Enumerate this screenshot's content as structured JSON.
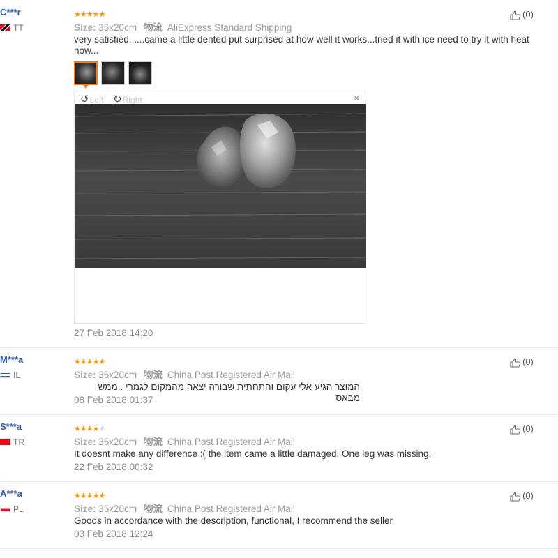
{
  "reviews": [
    {
      "user": "C***r",
      "country": "TT",
      "rating": 5,
      "size_label": "Size:",
      "size_value": "35x20cm",
      "ship_icon": "物流",
      "shipping": "AliExpress Standard Shipping",
      "text": "very satisfied. ....came a little dented put surprised at how well it works...tried it with ice need to try it with heat now...",
      "date": "27 Feb 2018 14:20",
      "helpful": "(0)",
      "viewer": {
        "rotate_left": "Left",
        "rotate_right": "Right",
        "close": "×"
      }
    },
    {
      "user": "M***a",
      "country": "IL",
      "rating": 5,
      "size_label": "Size:",
      "size_value": "35x20cm",
      "ship_icon": "物流",
      "shipping": "China Post Registered Air Mail",
      "text": "המוצר הגיע אלי עקום והתחתית שבורה יצאה מהמקום לגמרי ..ממש מבאס",
      "date": "08 Feb 2018 01:37",
      "helpful": "(0)"
    },
    {
      "user": "S***a",
      "country": "TR",
      "rating": 4,
      "size_label": "Size:",
      "size_value": "35x20cm",
      "ship_icon": "物流",
      "shipping": "China Post Registered Air Mail",
      "text": "It doesnt make any difference :( the item came a little damaged. One leg was missing.",
      "date": "22 Feb 2018 00:32",
      "helpful": "(0)"
    },
    {
      "user": "A***a",
      "country": "PL",
      "rating": 5,
      "size_label": "Size:",
      "size_value": "35x20cm",
      "ship_icon": "物流",
      "shipping": "China Post Registered Air Mail",
      "text": "Goods in accordance with the description, functional, I recommend the seller",
      "date": "03 Feb 2018 12:24",
      "helpful": "(0)"
    }
  ],
  "colors": {
    "star": "#ff8c00",
    "user_link": "#2a5db0",
    "thumb_active_border": "#f07b1b"
  },
  "icons": {
    "helpful": "thumbs-up-icon",
    "rotate_left": "rotate-left-icon",
    "rotate_right": "rotate-right-icon",
    "close": "close-icon"
  }
}
